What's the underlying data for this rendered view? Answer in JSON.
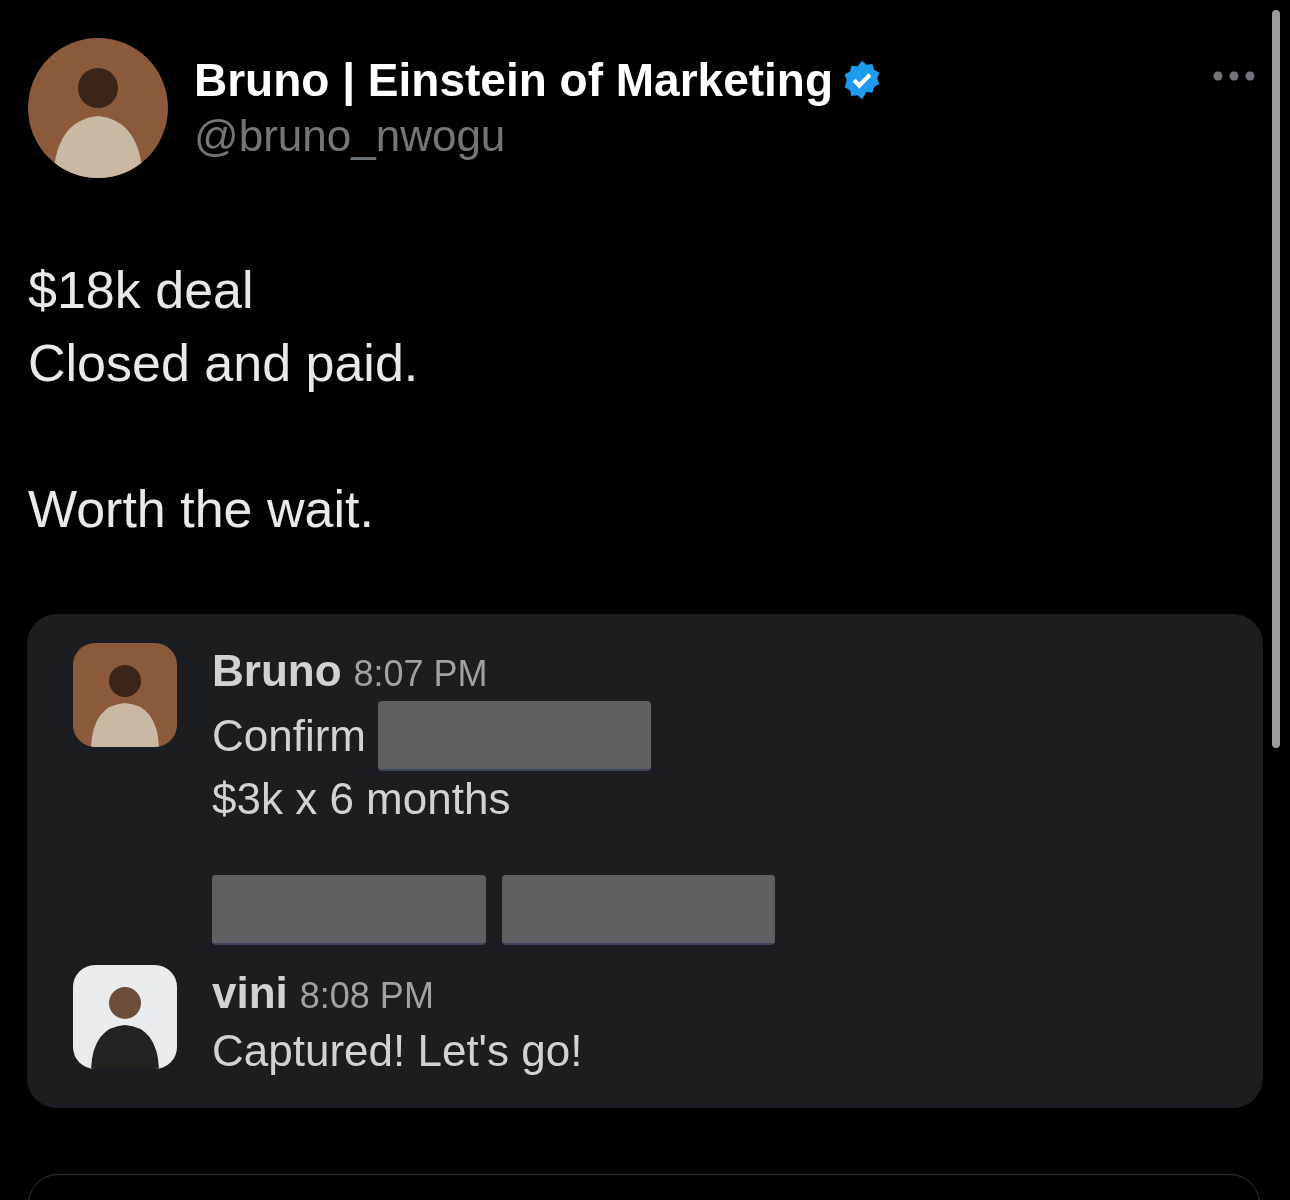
{
  "author": {
    "name": "Bruno | Einstein of Marketing",
    "verified": true,
    "handle": "@bruno_nwogu"
  },
  "paragraphs": [
    {
      "lines": [
        "$18k deal",
        "Closed and paid."
      ]
    },
    {
      "lines": [
        "Worth the wait."
      ]
    }
  ],
  "messages": [
    {
      "author": "Bruno",
      "time": "8:07 PM",
      "lines": [
        {
          "kind": "text_redacted",
          "text": "Confirm"
        },
        {
          "kind": "text",
          "text": "$3k x 6 months"
        },
        {
          "kind": "redacted_pair"
        }
      ]
    },
    {
      "author": "vini",
      "time": "8:08 PM",
      "lines": [
        {
          "kind": "text",
          "text": "Captured! Let's go!"
        }
      ]
    }
  ]
}
